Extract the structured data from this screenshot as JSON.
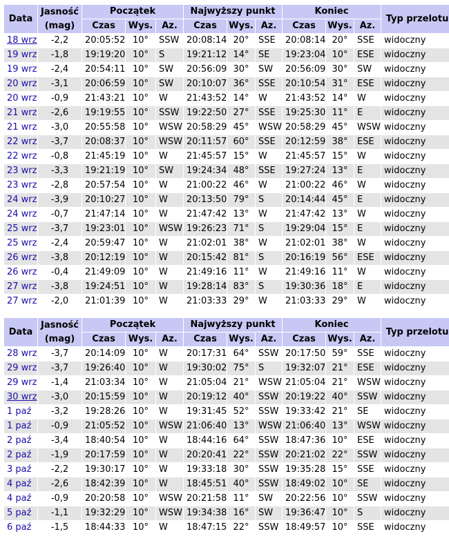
{
  "headers": {
    "data": "Data",
    "jasnosc": "Jasność",
    "mag": "(mag)",
    "poczatek": "Początek",
    "najwyzszy": "Najwyższy punkt",
    "koniec": "Koniec",
    "typ": "Typ przelotu",
    "czas": "Czas",
    "wys": "Wys.",
    "az": "Az."
  },
  "colors": {
    "header_bg": "#c8c8f4",
    "row_even_bg": "#e4e4e4",
    "link": "#1a0dab"
  },
  "tables": [
    {
      "rows": [
        [
          "18 wrz",
          "-2,2",
          "20:05:52",
          "10°",
          "SSW",
          "20:08:14",
          "20°",
          "SSE",
          "20:08:14",
          "20°",
          "SSE",
          "widoczny"
        ],
        [
          "19 wrz",
          "-1,8",
          "19:19:20",
          "10°",
          "S",
          "19:21:12",
          "14°",
          "SE",
          "19:23:04",
          "10°",
          "ESE",
          "widoczny"
        ],
        [
          "19 wrz",
          "-2,4",
          "20:54:11",
          "10°",
          "SW",
          "20:56:09",
          "30°",
          "SW",
          "20:56:09",
          "30°",
          "SW",
          "widoczny"
        ],
        [
          "20 wrz",
          "-3,1",
          "20:06:59",
          "10°",
          "SW",
          "20:10:07",
          "36°",
          "SSE",
          "20:10:54",
          "31°",
          "ESE",
          "widoczny"
        ],
        [
          "20 wrz",
          "-0,9",
          "21:43:21",
          "10°",
          "W",
          "21:43:52",
          "14°",
          "W",
          "21:43:52",
          "14°",
          "W",
          "widoczny"
        ],
        [
          "21 wrz",
          "-2,6",
          "19:19:55",
          "10°",
          "SSW",
          "19:22:50",
          "27°",
          "SSE",
          "19:25:30",
          "11°",
          "E",
          "widoczny"
        ],
        [
          "21 wrz",
          "-3,0",
          "20:55:58",
          "10°",
          "WSW",
          "20:58:29",
          "45°",
          "WSW",
          "20:58:29",
          "45°",
          "WSW",
          "widoczny"
        ],
        [
          "22 wrz",
          "-3,7",
          "20:08:37",
          "10°",
          "WSW",
          "20:11:57",
          "60°",
          "SSE",
          "20:12:59",
          "38°",
          "ESE",
          "widoczny"
        ],
        [
          "22 wrz",
          "-0,8",
          "21:45:19",
          "10°",
          "W",
          "21:45:57",
          "15°",
          "W",
          "21:45:57",
          "15°",
          "W",
          "widoczny"
        ],
        [
          "23 wrz",
          "-3,3",
          "19:21:19",
          "10°",
          "SW",
          "19:24:34",
          "48°",
          "SSE",
          "19:27:24",
          "13°",
          "E",
          "widoczny"
        ],
        [
          "23 wrz",
          "-2,8",
          "20:57:54",
          "10°",
          "W",
          "21:00:22",
          "46°",
          "W",
          "21:00:22",
          "46°",
          "W",
          "widoczny"
        ],
        [
          "24 wrz",
          "-3,9",
          "20:10:27",
          "10°",
          "W",
          "20:13:50",
          "79°",
          "S",
          "20:14:44",
          "45°",
          "E",
          "widoczny"
        ],
        [
          "24 wrz",
          "-0,7",
          "21:47:14",
          "10°",
          "W",
          "21:47:42",
          "13°",
          "W",
          "21:47:42",
          "13°",
          "W",
          "widoczny"
        ],
        [
          "25 wrz",
          "-3,7",
          "19:23:01",
          "10°",
          "WSW",
          "19:26:23",
          "71°",
          "S",
          "19:29:04",
          "15°",
          "E",
          "widoczny"
        ],
        [
          "25 wrz",
          "-2,4",
          "20:59:47",
          "10°",
          "W",
          "21:02:01",
          "38°",
          "W",
          "21:02:01",
          "38°",
          "W",
          "widoczny"
        ],
        [
          "26 wrz",
          "-3,8",
          "20:12:19",
          "10°",
          "W",
          "20:15:42",
          "81°",
          "S",
          "20:16:19",
          "56°",
          "ESE",
          "widoczny"
        ],
        [
          "26 wrz",
          "-0,4",
          "21:49:09",
          "10°",
          "W",
          "21:49:16",
          "11°",
          "W",
          "21:49:16",
          "11°",
          "W",
          "widoczny"
        ],
        [
          "27 wrz",
          "-3,8",
          "19:24:51",
          "10°",
          "W",
          "19:28:14",
          "83°",
          "S",
          "19:30:36",
          "18°",
          "E",
          "widoczny"
        ],
        [
          "27 wrz",
          "-2,0",
          "21:01:39",
          "10°",
          "W",
          "21:03:33",
          "29°",
          "W",
          "21:03:33",
          "29°",
          "W",
          "widoczny"
        ]
      ],
      "underlined_rows": [
        0
      ]
    },
    {
      "rows": [
        [
          "28 wrz",
          "-3,7",
          "20:14:09",
          "10°",
          "W",
          "20:17:31",
          "64°",
          "SSW",
          "20:17:50",
          "59°",
          "SSE",
          "widoczny"
        ],
        [
          "29 wrz",
          "-3,7",
          "19:26:40",
          "10°",
          "W",
          "19:30:02",
          "75°",
          "S",
          "19:32:07",
          "21°",
          "ESE",
          "widoczny"
        ],
        [
          "29 wrz",
          "-1,4",
          "21:03:34",
          "10°",
          "W",
          "21:05:04",
          "21°",
          "WSW",
          "21:05:04",
          "21°",
          "WSW",
          "widoczny"
        ],
        [
          "30 wrz",
          "-3,0",
          "20:15:59",
          "10°",
          "W",
          "20:19:12",
          "40°",
          "SSW",
          "20:19:22",
          "40°",
          "SSW",
          "widoczny"
        ],
        [
          "1 paź",
          "-3,2",
          "19:28:26",
          "10°",
          "W",
          "19:31:45",
          "52°",
          "SSW",
          "19:33:42",
          "21°",
          "SE",
          "widoczny"
        ],
        [
          "1 paź",
          "-0,9",
          "21:05:52",
          "10°",
          "WSW",
          "21:06:40",
          "13°",
          "WSW",
          "21:06:40",
          "13°",
          "WSW",
          "widoczny"
        ],
        [
          "2 paź",
          "-3,4",
          "18:40:54",
          "10°",
          "W",
          "18:44:16",
          "64°",
          "SSW",
          "18:47:36",
          "10°",
          "ESE",
          "widoczny"
        ],
        [
          "2 paź",
          "-1,9",
          "20:17:59",
          "10°",
          "W",
          "20:20:41",
          "22°",
          "SSW",
          "20:21:02",
          "22°",
          "SSW",
          "widoczny"
        ],
        [
          "3 paź",
          "-2,2",
          "19:30:17",
          "10°",
          "W",
          "19:33:18",
          "30°",
          "SSW",
          "19:35:28",
          "15°",
          "SSE",
          "widoczny"
        ],
        [
          "4 paź",
          "-2,6",
          "18:42:39",
          "10°",
          "W",
          "18:45:51",
          "40°",
          "SSW",
          "18:49:02",
          "10°",
          "SE",
          "widoczny"
        ],
        [
          "4 paź",
          "-0,9",
          "20:20:58",
          "10°",
          "WSW",
          "20:21:58",
          "11°",
          "SW",
          "20:22:56",
          "10°",
          "SSW",
          "widoczny"
        ],
        [
          "5 paź",
          "-1,1",
          "19:32:29",
          "10°",
          "WSW",
          "19:34:38",
          "16°",
          "SW",
          "19:36:47",
          "10°",
          "S",
          "widoczny"
        ],
        [
          "6 paź",
          "-1,5",
          "18:44:33",
          "10°",
          "W",
          "18:47:15",
          "22°",
          "SSW",
          "18:49:57",
          "10°",
          "SSE",
          "widoczny"
        ]
      ],
      "underlined_rows": [
        3
      ]
    }
  ]
}
